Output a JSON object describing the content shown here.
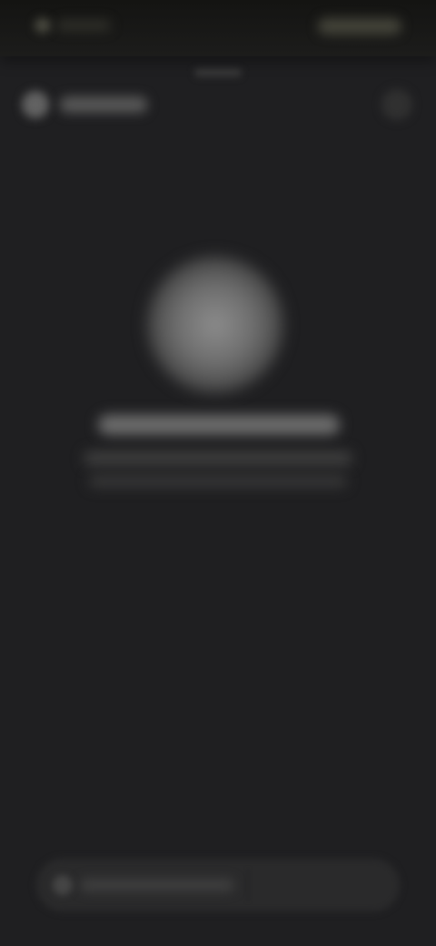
{
  "status_bar": {
    "time": "",
    "indicators": ""
  },
  "header": {
    "brand_label": "",
    "menu_icon": "menu-icon"
  },
  "hero": {
    "headline": "",
    "subtext": ""
  },
  "bottom_bar": {
    "label": "",
    "icon": "action-icon"
  },
  "colors": {
    "background": "#1f1f21",
    "status_bar": "#141412"
  }
}
